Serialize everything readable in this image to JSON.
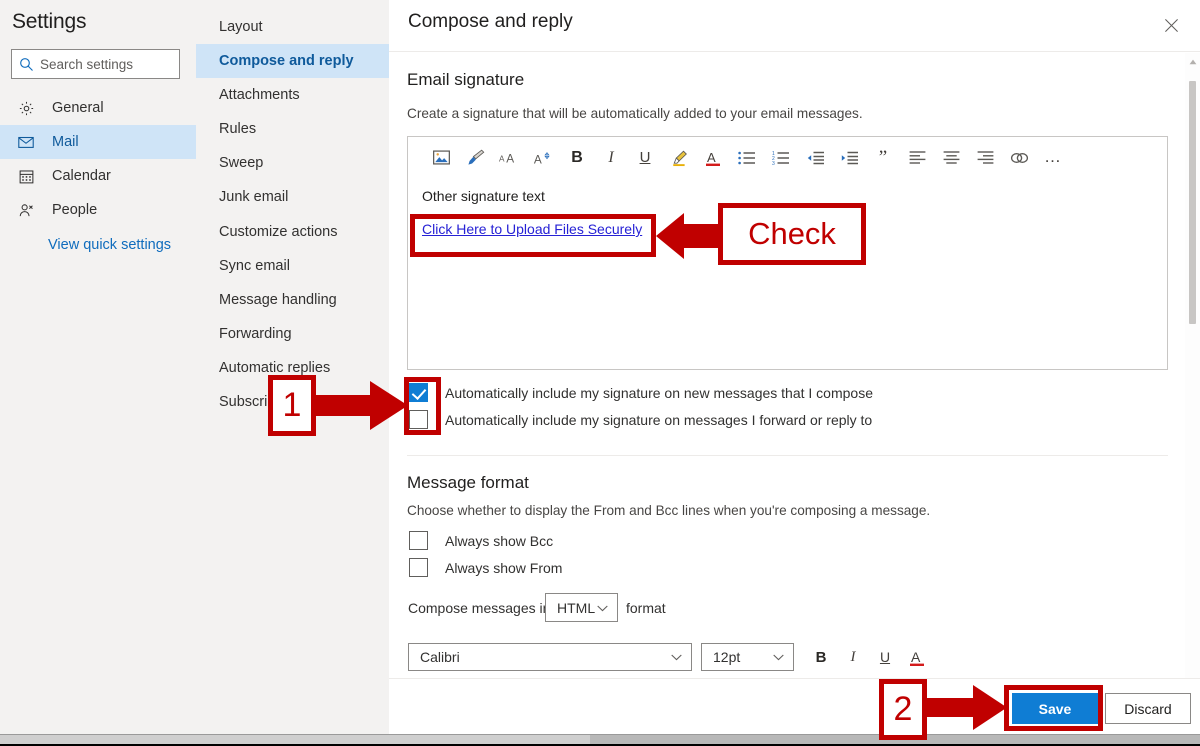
{
  "sidebar": {
    "title": "Settings",
    "search": {
      "placeholder": "Search settings",
      "value": "",
      "icon": "search-icon"
    },
    "items": [
      {
        "label": "General",
        "icon": "gear-icon",
        "selected": false
      },
      {
        "label": "Mail",
        "icon": "envelope-icon",
        "selected": true
      },
      {
        "label": "Calendar",
        "icon": "calendar-icon",
        "selected": false
      },
      {
        "label": "People",
        "icon": "person-icon",
        "selected": false
      }
    ],
    "quick_settings_link": "View quick settings"
  },
  "nav": {
    "items": [
      {
        "label": "Layout",
        "selected": false
      },
      {
        "label": "Compose and reply",
        "selected": true
      },
      {
        "label": "Attachments",
        "selected": false
      },
      {
        "label": "Rules",
        "selected": false
      },
      {
        "label": "Sweep",
        "selected": false
      },
      {
        "label": "Junk email",
        "selected": false
      },
      {
        "label": "Customize actions",
        "selected": false
      },
      {
        "label": "Sync email",
        "selected": false
      },
      {
        "label": "Message handling",
        "selected": false
      },
      {
        "label": "Forwarding",
        "selected": false
      },
      {
        "label": "Automatic replies",
        "selected": false
      },
      {
        "label": "Subscriptions",
        "selected": false
      }
    ]
  },
  "pane": {
    "title": "Compose and reply",
    "close_icon": "close-icon",
    "signature": {
      "heading": "Email signature",
      "description": "Create a signature that will be automatically added to your email messages.",
      "toolbar": [
        {
          "name": "insert-picture-icon",
          "glyph": "picture"
        },
        {
          "name": "format-painter-icon",
          "glyph": "brush"
        },
        {
          "name": "grow-font-icon",
          "glyph": "AA"
        },
        {
          "name": "shrink-font-icon",
          "glyph": "A"
        },
        {
          "name": "bold-icon",
          "glyph": "B"
        },
        {
          "name": "italic-icon",
          "glyph": "I"
        },
        {
          "name": "underline-icon",
          "glyph": "U"
        },
        {
          "name": "highlight-icon",
          "glyph": "highlight"
        },
        {
          "name": "font-color-icon",
          "glyph": "A"
        },
        {
          "name": "bulleted-list-icon",
          "glyph": "bullets"
        },
        {
          "name": "numbered-list-icon",
          "glyph": "numbers"
        },
        {
          "name": "decrease-indent-icon",
          "glyph": "outdent"
        },
        {
          "name": "increase-indent-icon",
          "glyph": "indent"
        },
        {
          "name": "quote-icon",
          "glyph": "”"
        },
        {
          "name": "align-left-icon",
          "glyph": "alignleft"
        },
        {
          "name": "align-center-icon",
          "glyph": "aligncenter"
        },
        {
          "name": "align-right-icon",
          "glyph": "alignright"
        },
        {
          "name": "insert-link-icon",
          "glyph": "link"
        },
        {
          "name": "more-options-icon",
          "glyph": "…"
        }
      ],
      "body_text": "Other signature text",
      "link_text": "Click Here to Upload Files Securely",
      "checkboxes": [
        {
          "label": "Automatically include my signature on new messages that I compose",
          "checked": true
        },
        {
          "label": "Automatically include my signature on messages I forward or reply to",
          "checked": false
        }
      ]
    },
    "message_format": {
      "heading": "Message format",
      "description": "Choose whether to display the From and Bcc lines when you're composing a message.",
      "checkboxes": [
        {
          "label": "Always show Bcc",
          "checked": false
        },
        {
          "label": "Always show From",
          "checked": false
        }
      ],
      "compose_prefix": "Compose messages in",
      "compose_format": "HTML",
      "compose_suffix": "format",
      "font_family": "Calibri",
      "font_size": "12pt",
      "style_buttons": [
        {
          "name": "bold-icon",
          "glyph": "B"
        },
        {
          "name": "italic-icon",
          "glyph": "I"
        },
        {
          "name": "underline-icon",
          "glyph": "U"
        },
        {
          "name": "font-color-icon",
          "glyph": "A"
        }
      ]
    },
    "footer": {
      "save_label": "Save",
      "discard_label": "Discard"
    }
  },
  "annotations": {
    "step1_label": "1",
    "step2_label": "2",
    "check_label": "Check",
    "color": "#c00000"
  },
  "colors": {
    "accent_blue": "#0f7dd4",
    "selection_blue": "#cfe4f7",
    "link_blue": "#0f6cbd",
    "signature_link": "#2621d5",
    "panel_gray": "#f3f2f1",
    "annotation_red": "#c00000"
  }
}
